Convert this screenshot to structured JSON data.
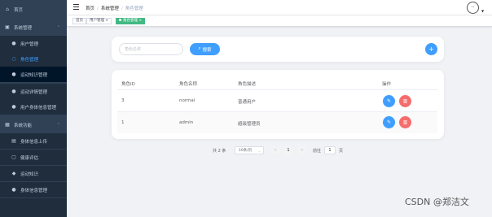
{
  "sidebar": {
    "home": "首页",
    "group1": "系统管理",
    "g1_items": [
      "用户管理",
      "角色管理",
      "运动知识管理",
      "运动详情管理",
      "用户身体信息管理"
    ],
    "group2": "系统功能",
    "g2_items": [
      "身体信息上传",
      "健康评估",
      "运动知识",
      "身体信息管理"
    ]
  },
  "header": {
    "crumbs": [
      "首页",
      "系统管理",
      "角色管理"
    ],
    "avatar_glyph": "··"
  },
  "tags": [
    "首页",
    "用户管理 ×",
    "角色管理 ×"
  ],
  "search": {
    "placeholder": "角色名称",
    "button": "搜索",
    "add": "+"
  },
  "table": {
    "headers": [
      "角色ID",
      "角色名称",
      "角色描述",
      "操作"
    ],
    "rows": [
      {
        "id": "3",
        "name": "normal",
        "desc": "普通用户"
      },
      {
        "id": "1",
        "name": "admin",
        "desc": "超级管理员"
      }
    ]
  },
  "pagination": {
    "total": "共 2 条",
    "page_size": "10条/页",
    "prev": "<",
    "current": "1",
    "next": ">",
    "goto_label": "前往",
    "goto_value": "1",
    "goto_suffix": "页"
  },
  "watermark": "CSDN @郑洁文",
  "colors": {
    "sidebar_bg": "#304156",
    "primary": "#409eff",
    "danger": "#f56c6c",
    "tag_active": "#42b983"
  }
}
